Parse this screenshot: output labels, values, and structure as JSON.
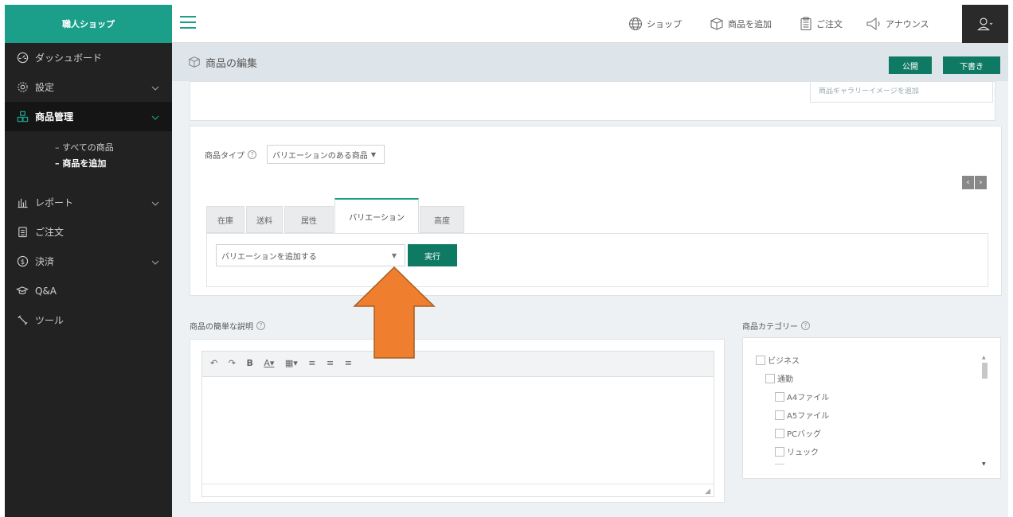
{
  "brand": "職人ショップ",
  "sidebar": {
    "items": [
      {
        "label": "ダッシュボード",
        "icon": "dashboard-icon"
      },
      {
        "label": "設定",
        "icon": "settings-icon"
      },
      {
        "label": "商品管理",
        "icon": "product-management-icon"
      },
      {
        "label": "レポート",
        "icon": "report-icon"
      },
      {
        "label": "ご注文",
        "icon": "order-icon"
      },
      {
        "label": "決済",
        "icon": "payment-icon"
      },
      {
        "label": "Q&A",
        "icon": "qa-icon"
      },
      {
        "label": "ツール",
        "icon": "tools-icon"
      }
    ],
    "sub_items": [
      "– すべての商品",
      "– 商品を追加"
    ]
  },
  "topbar": {
    "shop": "ショップ",
    "add_product": "商品を追加",
    "orders": "ご注文",
    "announce": "アナウンス"
  },
  "subhead": {
    "title": "商品の編集",
    "publish": "公開",
    "draft": "下書き"
  },
  "gallery_link": "商品ギャラリーイメージを追加",
  "product_type": {
    "label": "商品タイプ",
    "value": "バリエーションのある商品"
  },
  "tabs": [
    "在庫",
    "送料",
    "属性",
    "バリエーション",
    "高度"
  ],
  "variation": {
    "select_value": "バリエーションを追加する",
    "run_button": "実行"
  },
  "short_desc_label": "商品の簡単な説明",
  "editor_tools": [
    "↶",
    "↷",
    "B",
    "A▾",
    "▦▾",
    "≡",
    "≡",
    "≡"
  ],
  "categories": {
    "label": "商品カテゴリー",
    "items": [
      {
        "label": "ビジネス",
        "level": 0
      },
      {
        "label": "通勤",
        "level": 1
      },
      {
        "label": "A4ファイル",
        "level": 2
      },
      {
        "label": "A5ファイル",
        "level": 2
      },
      {
        "label": "PCバッグ",
        "level": 2
      },
      {
        "label": "リュック",
        "level": 2
      }
    ]
  },
  "colors": {
    "accent": "#1b9e8a",
    "button": "#0f7a63",
    "arrow": "#ef7f2f"
  }
}
